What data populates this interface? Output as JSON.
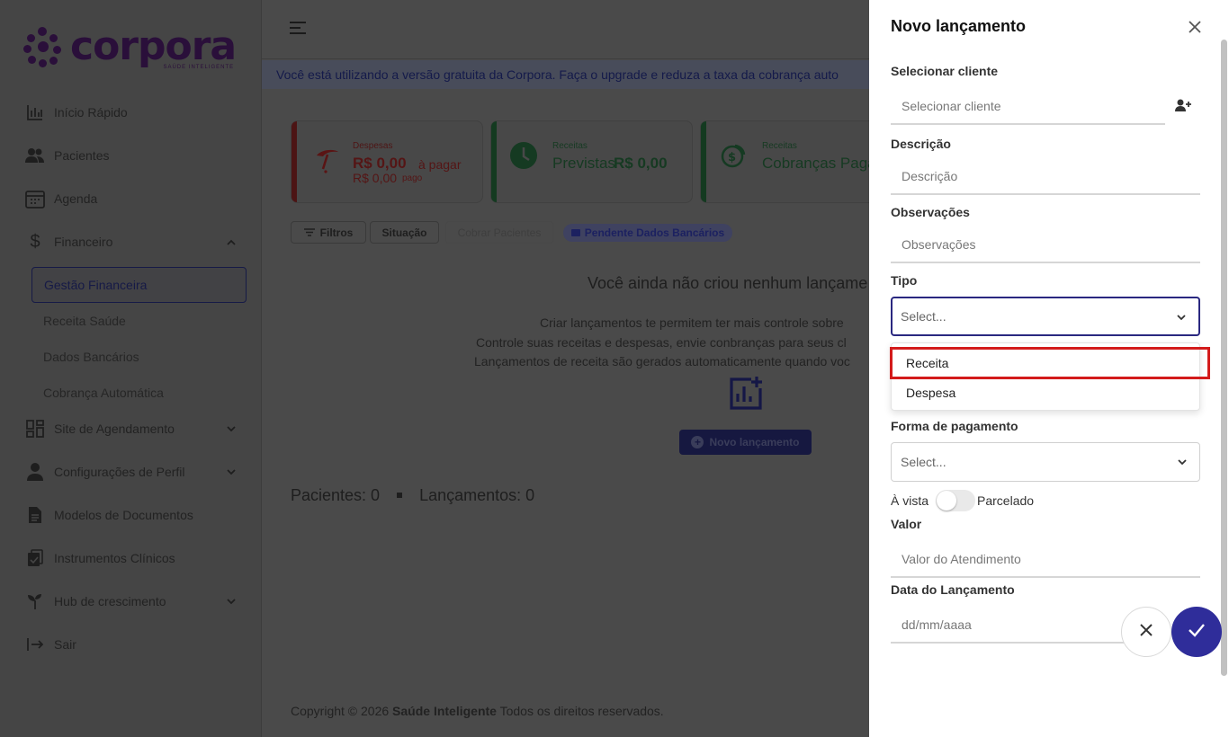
{
  "sidebar": {
    "brand": "corpora",
    "brand_sub": "SAÚDE INTELIGENTE",
    "items": [
      {
        "label": "Início Rápido",
        "icon": "chart-bar-icon"
      },
      {
        "label": "Pacientes",
        "icon": "users-icon"
      },
      {
        "label": "Agenda",
        "icon": "calendar-icon"
      },
      {
        "label": "Financeiro",
        "icon": "dollar-icon"
      },
      {
        "label": "Site de Agendamento",
        "icon": "grid-icon"
      },
      {
        "label": "Configurações de Perfil",
        "icon": "user-icon"
      },
      {
        "label": "Modelos de Documentos",
        "icon": "document-icon"
      },
      {
        "label": "Instrumentos Clínicos",
        "icon": "clipboard-icon"
      },
      {
        "label": "Hub de crescimento",
        "icon": "sprout-icon"
      },
      {
        "label": "Sair",
        "icon": "logout-icon"
      }
    ],
    "sub_items": [
      "Gestão Financeira",
      "Receita Saúde",
      "Dados Bancários",
      "Cobrança Automática"
    ]
  },
  "banner": "Você está utilizando a versão gratuita da Corpora. Faça o upgrade e reduza a taxa da cobrança auto",
  "cards": {
    "despesas": {
      "label": "Despesas",
      "value": "R$ 0,00",
      "suffix": "à pagar",
      "paid": "R$ 0,00",
      "paid_suffix": "pago"
    },
    "receitas": {
      "label": "Receitas",
      "prefix": "Previstas",
      "value": "R$ 0,00"
    },
    "cobrancas": {
      "label": "Receitas",
      "value": "Cobranças Pagas"
    }
  },
  "toolbar": {
    "filtros": "Filtros",
    "situacao": "Situação",
    "cobrar": "Cobrar Pacientes",
    "pendente": "Pendente Dados Bancários"
  },
  "empty": {
    "title": "Você ainda não criou nenhum lançame",
    "line1": "Criar lançamentos te permitem ter mais controle sobre",
    "line2": "Controle suas receitas e despesas, envie conbranças para seus cl",
    "line3": "Lançamentos de receita são gerados automaticamente quando voc",
    "button": "Novo lançamento"
  },
  "counts": {
    "pacientes": "Pacientes: 0",
    "lancamentos": "Lançamentos: 0"
  },
  "footer": {
    "prefix": "Copyright © 2026 ",
    "brand": "Saúde Inteligente",
    "suffix": " Todos os direitos reservados."
  },
  "drawer": {
    "title": "Novo lançamento",
    "cliente_label": "Selecionar cliente",
    "cliente_placeholder": "Selecionar cliente",
    "descricao_label": "Descrição",
    "descricao_placeholder": "Descrição",
    "obs_label": "Observações",
    "obs_placeholder": "Observações",
    "tipo_label": "Tipo",
    "tipo_value": "Select...",
    "tipo_options": [
      "Receita",
      "Despesa"
    ],
    "pagamento_label": "Forma de pagamento",
    "pagamento_value": "Select...",
    "a_vista": "À vista",
    "parcelado": "Parcelado",
    "valor_label": "Valor",
    "valor_placeholder": "Valor do Atendimento",
    "data_label": "Data do Lançamento",
    "data_placeholder": "dd/mm/aaaa"
  },
  "colors": {
    "accent": "#2f2d9a",
    "highlight": "#d31b1b"
  }
}
